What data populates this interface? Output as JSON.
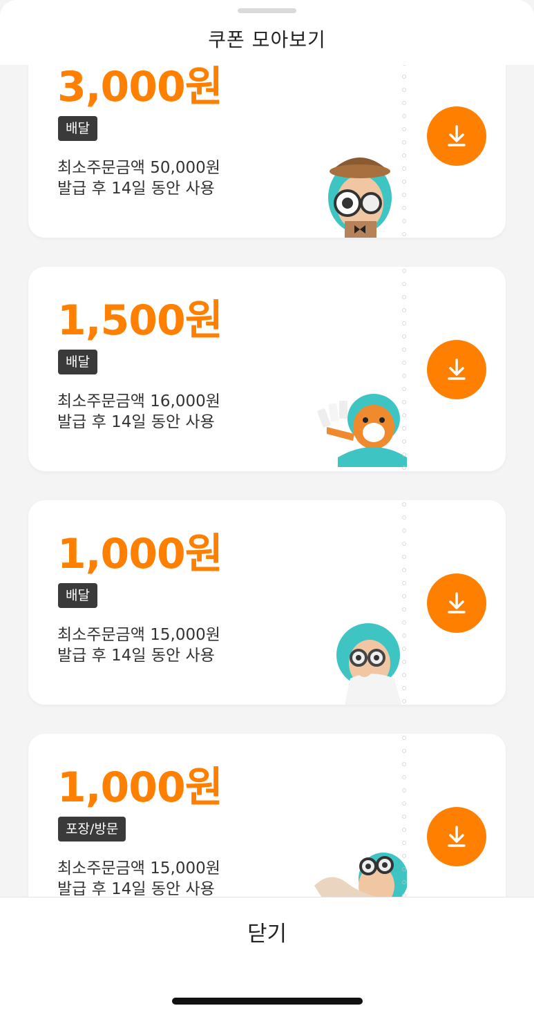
{
  "header": {
    "title": "쿠폰 모아보기"
  },
  "coupons": [
    {
      "amount": "3,000원",
      "tag": "배달",
      "min_order": "최소주문금액 50,000원",
      "validity": "발급 후 14일 동안 사용",
      "mascot": "detective-mascot"
    },
    {
      "amount": "1,500원",
      "tag": "배달",
      "min_order": "최소주문금액 16,000원",
      "validity": "발급 후 14일 동안 사용",
      "mascot": "cat-coupons-mascot"
    },
    {
      "amount": "1,000원",
      "tag": "배달",
      "min_order": "최소주문금액 15,000원",
      "validity": "발급 후 14일 동안 사용",
      "mascot": "goggles-mascot"
    },
    {
      "amount": "1,000원",
      "tag": "포장/방문",
      "min_order": "최소주문금액 15,000원",
      "validity": "발급 후 14일 동안 사용",
      "mascot": "peeking-mascot"
    }
  ],
  "download_icon": "download-icon",
  "footer": {
    "close_label": "닫기"
  },
  "colors": {
    "accent": "#ff8000",
    "tag_bg": "#3a3a3a",
    "background": "#f4f4f4"
  }
}
